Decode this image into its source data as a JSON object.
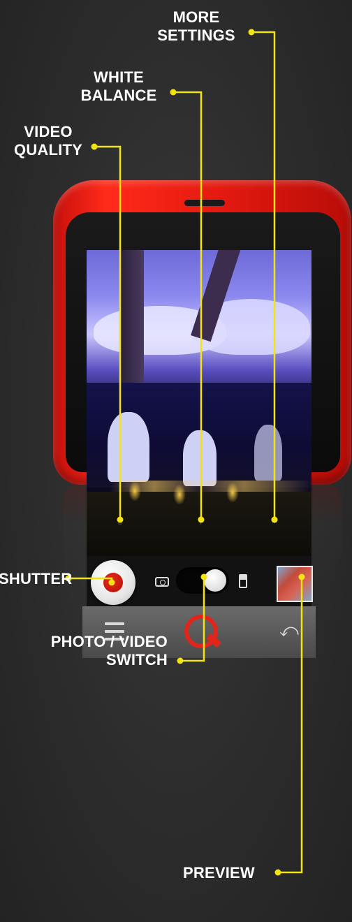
{
  "callouts": {
    "more_settings": [
      "MORE",
      "SETTINGS"
    ],
    "white_balance": [
      "WHITE",
      "BALANCE"
    ],
    "video_quality": [
      "VIDEO",
      "QUALITY"
    ],
    "shutter": "SHUTTER",
    "photo_video_switch": [
      "PHOTO / VIDEO",
      "SWITCH"
    ],
    "preview": "PREVIEW"
  },
  "icons": {
    "video_quality": "video-quality-icon",
    "white_balance": "white-balance-icon",
    "more_settings": "settings-gear-icon",
    "camera_mode": "camera-mode-icon",
    "video_mode": "video-mode-icon",
    "menu": "menu-icon",
    "logo": "app-logo-icon",
    "back": "back-icon"
  },
  "colors": {
    "callout_line": "#f2e312",
    "phone_body": "#e51a10",
    "shutter_dot": "#c0150a",
    "logo": "#e0261a"
  },
  "glyphs": {
    "back": "⤺",
    "settings": "⚙",
    "white_balance": "⚲",
    "video_quality": "▯"
  }
}
